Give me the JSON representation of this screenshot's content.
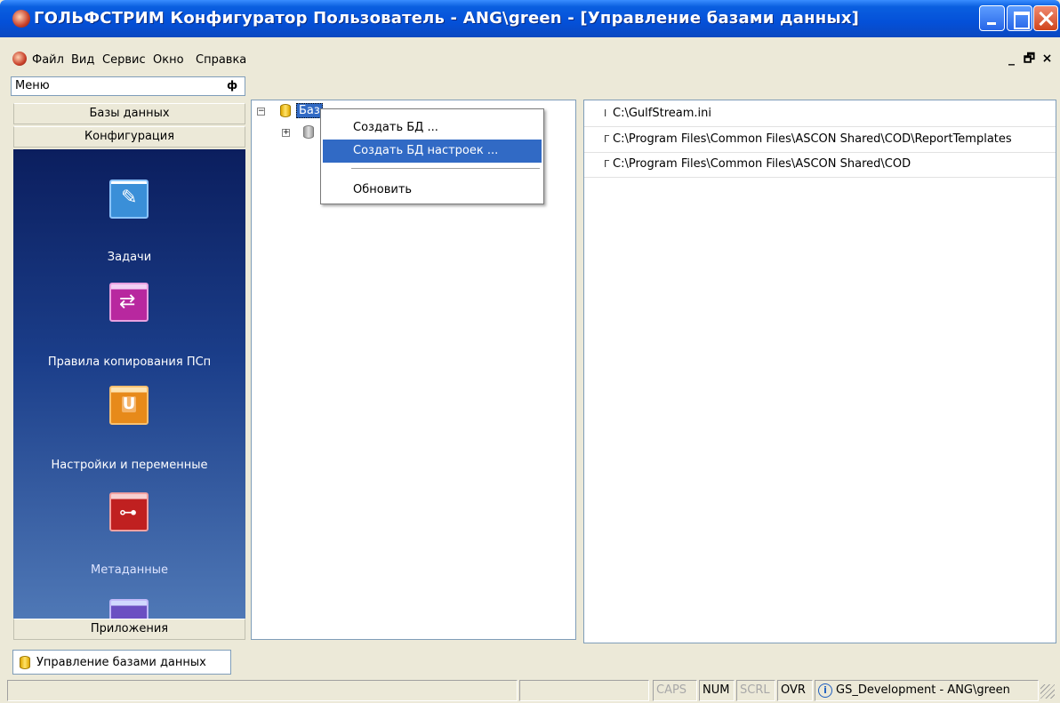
{
  "window": {
    "title": "ГОЛЬФСТРИМ Конфигуратор Пользователь - ANG\\green - [Управление базами данных]"
  },
  "menubar": {
    "items": [
      "Файл",
      "Вид",
      "Сервис",
      "Окно",
      "Справка"
    ],
    "mdi_controls": [
      "_",
      "🗗",
      "×"
    ]
  },
  "left_panel": {
    "caption": "Меню",
    "pin_icon": "pin-icon",
    "sections": [
      "Базы данных",
      "Конфигурация",
      "Приложения"
    ],
    "tools": [
      {
        "label": "Задачи",
        "icon": "tasks-icon"
      },
      {
        "label": "Правила копирования ПСп",
        "icon": "copy-rules-icon"
      },
      {
        "label": "Настройки и переменные",
        "icon": "settings-variables-icon"
      },
      {
        "label": "Метаданные",
        "icon": "metadata-icon"
      }
    ]
  },
  "tree": {
    "root_label": "Баз",
    "root_expander": "−",
    "child_expander": "+"
  },
  "context_menu": {
    "items": [
      "Создать БД ...",
      "Создать БД настроек ...",
      "Обновить"
    ],
    "hover_index": 1
  },
  "list": {
    "rows": [
      {
        "mark": "Ⅰ",
        "path": "C:\\GulfStream.ini"
      },
      {
        "mark": "Г",
        "path": "C:\\Program Files\\Common Files\\ASCON Shared\\COD\\ReportTemplates"
      },
      {
        "mark": "Г",
        "path": "C:\\Program Files\\Common Files\\ASCON Shared\\COD"
      }
    ]
  },
  "tabbar": {
    "tab_label": "Управление базами данных"
  },
  "statusbar": {
    "caps": "CAPS",
    "num": "NUM",
    "scrl": "SCRL",
    "ovr": "OVR",
    "connection": "GS_Development - ANG\\green"
  },
  "colors": {
    "titlebar": "#0450d8",
    "selection": "#316ac5",
    "panel_gradient_top": "#0b1e5e",
    "panel_gradient_bottom": "#4f78b6"
  }
}
